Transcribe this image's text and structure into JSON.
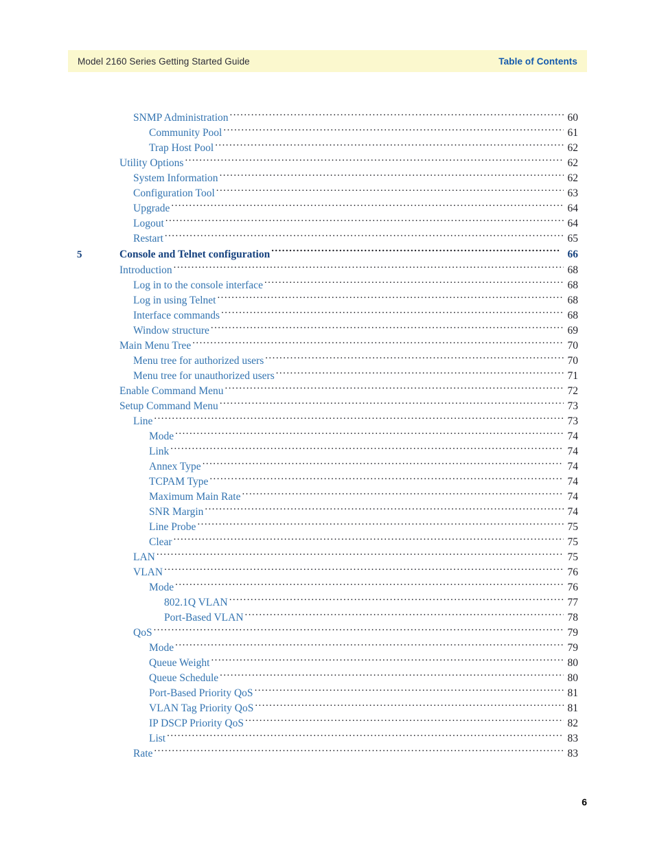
{
  "header": {
    "document_title": "Model 2160 Series Getting Started Guide",
    "section_title": "Table of Contents",
    "band_color": "#fbf8ce",
    "section_color": "#1259ad"
  },
  "footer": {
    "page_number": "6"
  },
  "toc": {
    "entries": [
      {
        "chapter": "",
        "level": 2,
        "label": "SNMP Administration",
        "page": "60",
        "bold": false
      },
      {
        "chapter": "",
        "level": 3,
        "label": "Community Pool",
        "page": "61",
        "bold": false
      },
      {
        "chapter": "",
        "level": 3,
        "label": "Trap Host Pool",
        "page": "62",
        "bold": false
      },
      {
        "chapter": "",
        "level": 1,
        "label": "Utility Options",
        "page": "62",
        "bold": false
      },
      {
        "chapter": "",
        "level": 2,
        "label": "System Information",
        "page": "62",
        "bold": false
      },
      {
        "chapter": "",
        "level": 2,
        "label": "Configuration Tool",
        "page": "63",
        "bold": false
      },
      {
        "chapter": "",
        "level": 2,
        "label": "Upgrade",
        "page": "64",
        "bold": false
      },
      {
        "chapter": "",
        "level": 2,
        "label": "Logout",
        "page": "64",
        "bold": false
      },
      {
        "chapter": "",
        "level": 2,
        "label": "Restart",
        "page": "65",
        "bold": false
      },
      {
        "chapter": "5",
        "level": 1,
        "label": "Console and Telnet configuration",
        "page": "66",
        "bold": true
      },
      {
        "chapter": "",
        "level": 1,
        "label": "Introduction",
        "page": "68",
        "bold": false
      },
      {
        "chapter": "",
        "level": 2,
        "label": "Log in to the console interface",
        "page": "68",
        "bold": false
      },
      {
        "chapter": "",
        "level": 2,
        "label": "Log in using Telnet",
        "page": "68",
        "bold": false
      },
      {
        "chapter": "",
        "level": 2,
        "label": "Interface commands",
        "page": "68",
        "bold": false
      },
      {
        "chapter": "",
        "level": 2,
        "label": "Window structure",
        "page": "69",
        "bold": false
      },
      {
        "chapter": "",
        "level": 1,
        "label": "Main Menu Tree",
        "page": "70",
        "bold": false
      },
      {
        "chapter": "",
        "level": 2,
        "label": "Menu tree for authorized users",
        "page": "70",
        "bold": false
      },
      {
        "chapter": "",
        "level": 2,
        "label": "Menu tree for unauthorized users",
        "page": "71",
        "bold": false
      },
      {
        "chapter": "",
        "level": 1,
        "label": "Enable Command Menu",
        "page": "72",
        "bold": false
      },
      {
        "chapter": "",
        "level": 1,
        "label": "Setup Command Menu",
        "page": "73",
        "bold": false
      },
      {
        "chapter": "",
        "level": 2,
        "label": "Line",
        "page": "73",
        "bold": false
      },
      {
        "chapter": "",
        "level": 3,
        "label": "Mode",
        "page": "74",
        "bold": false
      },
      {
        "chapter": "",
        "level": 3,
        "label": "Link",
        "page": "74",
        "bold": false
      },
      {
        "chapter": "",
        "level": 3,
        "label": "Annex Type",
        "page": "74",
        "bold": false
      },
      {
        "chapter": "",
        "level": 3,
        "label": "TCPAM Type",
        "page": "74",
        "bold": false
      },
      {
        "chapter": "",
        "level": 3,
        "label": "Maximum Main Rate",
        "page": "74",
        "bold": false
      },
      {
        "chapter": "",
        "level": 3,
        "label": "SNR Margin",
        "page": "74",
        "bold": false
      },
      {
        "chapter": "",
        "level": 3,
        "label": "Line Probe",
        "page": "75",
        "bold": false
      },
      {
        "chapter": "",
        "level": 3,
        "label": "Clear",
        "page": "75",
        "bold": false
      },
      {
        "chapter": "",
        "level": 2,
        "label": "LAN",
        "page": "75",
        "bold": false
      },
      {
        "chapter": "",
        "level": 2,
        "label": "VLAN",
        "page": "76",
        "bold": false
      },
      {
        "chapter": "",
        "level": 3,
        "label": "Mode",
        "page": "76",
        "bold": false
      },
      {
        "chapter": "",
        "level": 4,
        "label": "802.1Q VLAN",
        "page": "77",
        "bold": false
      },
      {
        "chapter": "",
        "level": 4,
        "label": "Port-Based VLAN",
        "page": "78",
        "bold": false
      },
      {
        "chapter": "",
        "level": 2,
        "label": "QoS",
        "page": "79",
        "bold": false
      },
      {
        "chapter": "",
        "level": 3,
        "label": "Mode",
        "page": "79",
        "bold": false
      },
      {
        "chapter": "",
        "level": 3,
        "label": "Queue Weight",
        "page": "80",
        "bold": false
      },
      {
        "chapter": "",
        "level": 3,
        "label": "Queue Schedule",
        "page": "80",
        "bold": false
      },
      {
        "chapter": "",
        "level": 3,
        "label": "Port-Based Priority QoS",
        "page": "81",
        "bold": false
      },
      {
        "chapter": "",
        "level": 3,
        "label": "VLAN Tag Priority QoS",
        "page": "81",
        "bold": false
      },
      {
        "chapter": "",
        "level": 3,
        "label": "IP DSCP Priority QoS",
        "page": "82",
        "bold": false
      },
      {
        "chapter": "",
        "level": 3,
        "label": "List",
        "page": "83",
        "bold": false
      },
      {
        "chapter": "",
        "level": 2,
        "label": "Rate",
        "page": "83",
        "bold": false
      }
    ]
  }
}
